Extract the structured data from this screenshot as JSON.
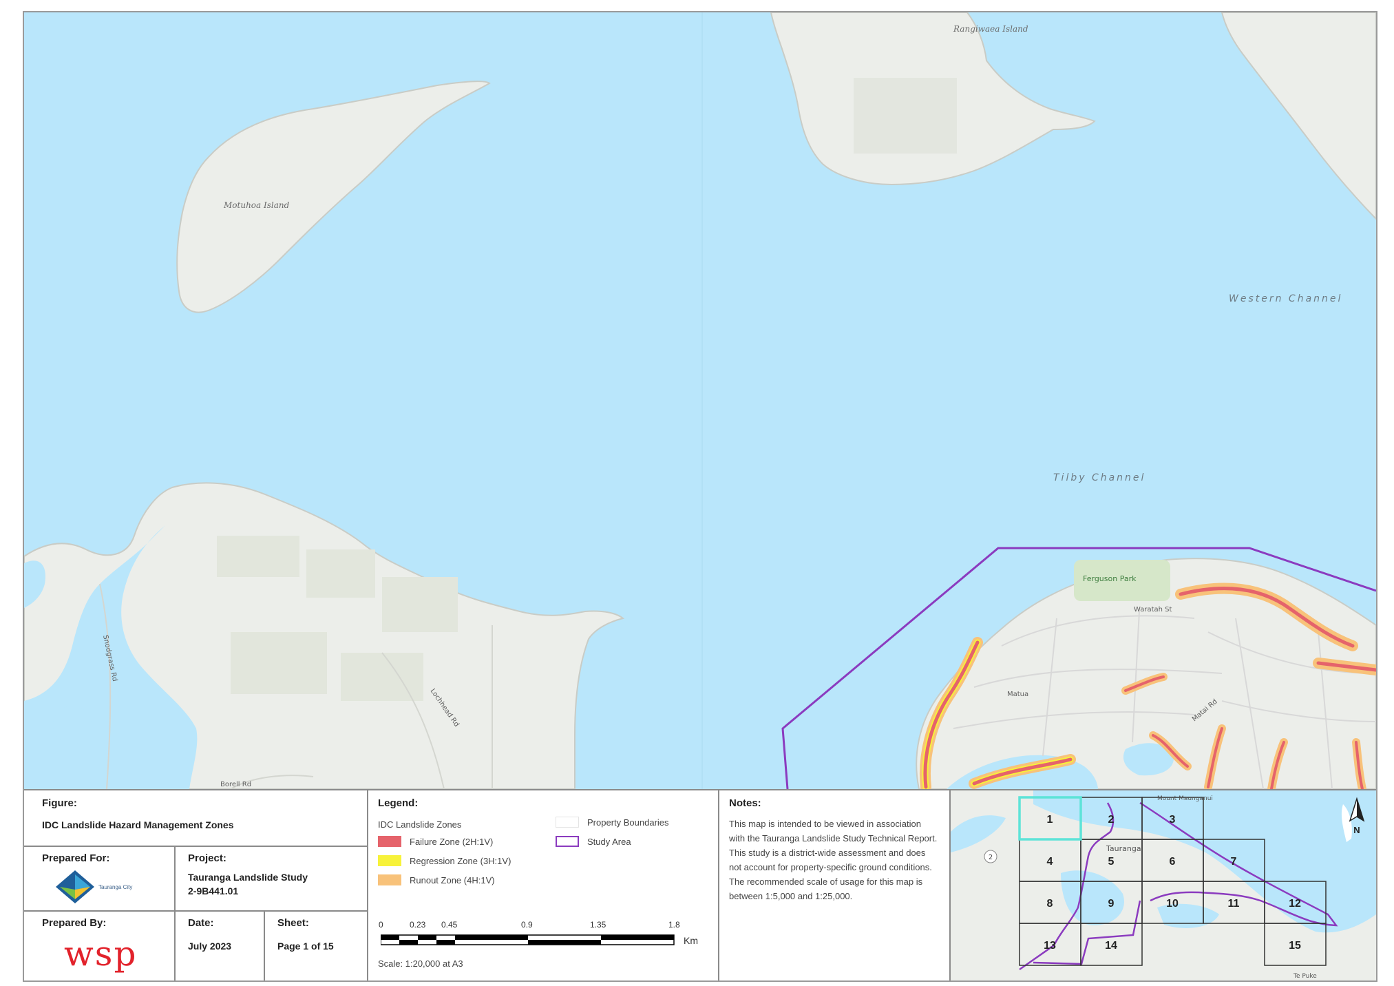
{
  "map": {
    "place_labels": {
      "motuhoa": "Motuhoa Island",
      "rangiwaea": "Rangiwaea Island",
      "western_channel": "Western Channel",
      "tilby_channel": "Tilby Channel",
      "ferguson_park": "Ferguson Park",
      "waratah": "Waratah St",
      "matua": "Matua",
      "snodgrass": "Snodgrass Rd",
      "lochhead": "Lochhead Rd",
      "borell": "Borell Rd",
      "matai": "Matai Rd"
    },
    "colors": {
      "water": "#b9e6fb",
      "land": "#eceeea",
      "failure": "#e5636b",
      "regression": "#f7f23a",
      "runout": "#f8c27a",
      "study_area": "#8b3bbf"
    }
  },
  "title_block": {
    "figure_label": "Figure:",
    "figure_title": "IDC Landslide Hazard Management Zones",
    "prepared_for_label": "Prepared For:",
    "client_logo_text": "Tauranga City",
    "project_label": "Project:",
    "project_name": "Tauranga Landslide Study",
    "project_number": "2-9B441.01",
    "prepared_by_label": "Prepared By:",
    "prepared_by_logo": "wsp",
    "date_label": "Date:",
    "date_value": "July 2023",
    "sheet_label": "Sheet:",
    "sheet_value": "Page 1 of 15"
  },
  "legend": {
    "heading": "Legend:",
    "group_title": "IDC Landslide Zones",
    "items": [
      {
        "label": "Failure Zone (2H:1V)",
        "color": "#e5636b"
      },
      {
        "label": "Regression Zone (3H:1V)",
        "color": "#f7f23a"
      },
      {
        "label": "Runout Zone (4H:1V)",
        "color": "#f8c27a"
      }
    ],
    "property_boundaries": "Property Boundaries",
    "study_area": "Study Area",
    "scale_ticks": [
      "0",
      "0.23",
      "0.45",
      "0.9",
      "1.35",
      "1.8"
    ],
    "scale_unit": "Km",
    "scale_text": "Scale: 1:20,000 at A3"
  },
  "notes": {
    "heading": "Notes:",
    "text": "This map is intended to be viewed in association with the Tauranga Landslide Study Technical Report. This study is a district-wide assessment and does not account for property-specific ground conditions. The recommended scale of usage for this map is between 1:5,000 and 1:25,000."
  },
  "index_map": {
    "sheets": [
      "1",
      "2",
      "3",
      "4",
      "5",
      "6",
      "7",
      "8",
      "9",
      "10",
      "11",
      "12",
      "13",
      "14",
      "15"
    ],
    "current_sheet": "1",
    "north_label": "N",
    "place_tauranga": "Tauranga",
    "place_mount": "Mount Maunganui",
    "place_tepuke": "Te Puke",
    "road_shield": "2"
  }
}
